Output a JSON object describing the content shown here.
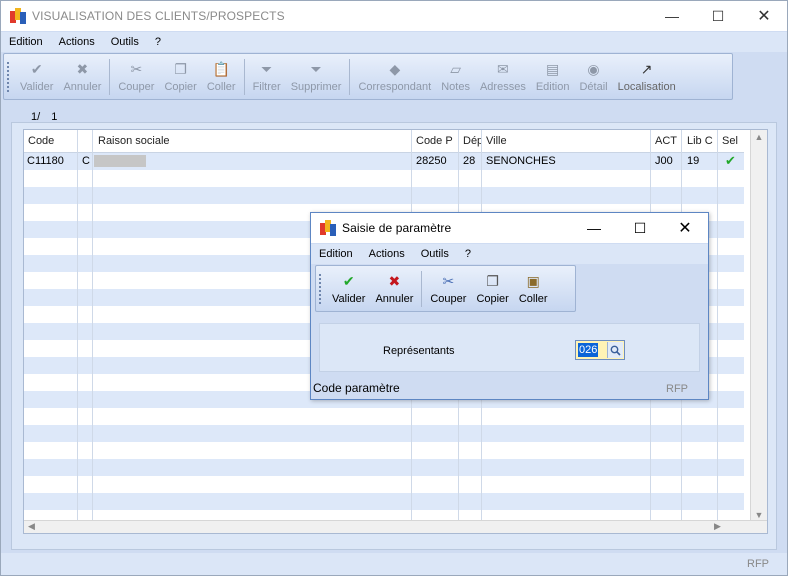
{
  "window": {
    "title": "VISUALISATION DES CLIENTS/PROSPECTS"
  },
  "menu": [
    "Edition",
    "Actions",
    "Outils",
    "?"
  ],
  "toolbar": {
    "valider": "Valider",
    "annuler": "Annuler",
    "couper": "Couper",
    "copier": "Copier",
    "coller": "Coller",
    "filtrer": "Filtrer",
    "supprimer": "Supprimer",
    "correspondant": "Correspondant",
    "notes": "Notes",
    "adresses": "Adresses",
    "edition": "Edition",
    "detail": "Détail",
    "localisation": "Localisation"
  },
  "pager": {
    "current": "1/",
    "total": "1"
  },
  "table": {
    "headers": [
      "Code",
      "Raison sociale",
      "Code P",
      "Dép",
      "Ville",
      "ACT",
      "Lib C",
      "Sel"
    ],
    "rows": [
      {
        "code": "C11180",
        "type": "C",
        "code_p": "28250",
        "dep": "28",
        "ville": "SENONCHES",
        "act": "J00",
        "lib_c": "19",
        "sel": "✔"
      }
    ]
  },
  "status": {
    "right": "RFP"
  },
  "dialog": {
    "title": "Saisie de paramètre",
    "menu": [
      "Edition",
      "Actions",
      "Outils",
      "?"
    ],
    "toolbar": {
      "valider": "Valider",
      "annuler": "Annuler",
      "couper": "Couper",
      "copier": "Copier",
      "coller": "Coller"
    },
    "field": {
      "label": "Représentants",
      "value": "026"
    },
    "status_left": "Code paramètre",
    "status_right": "RFP"
  },
  "colors": {
    "accent_green": "#22a82a",
    "accent_red": "#c4161c",
    "row_alt": "#dde8f9",
    "selection": "#0a64d8",
    "field_bg": "#fff3b5"
  }
}
